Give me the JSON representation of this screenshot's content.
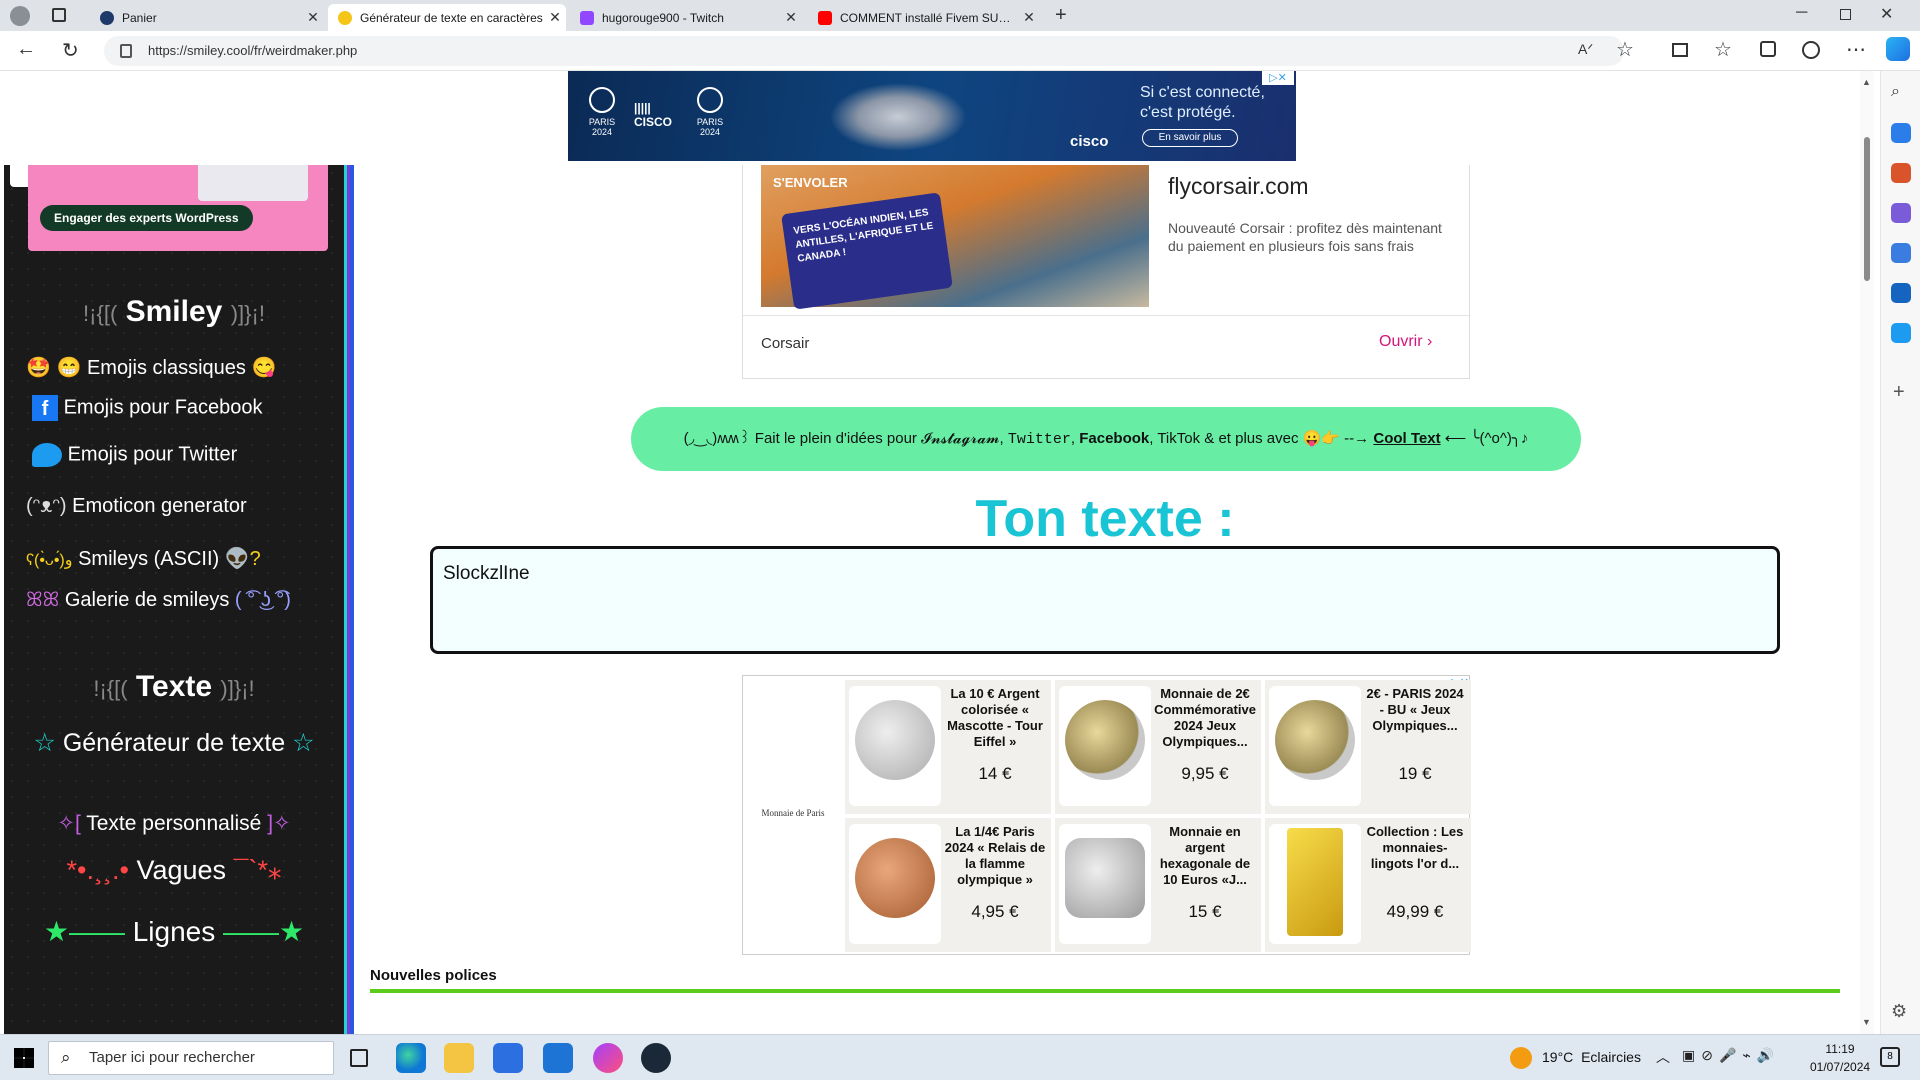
{
  "browser": {
    "tabs": [
      {
        "title": "Panier",
        "active": false
      },
      {
        "title": "Générateur de texte en caractères",
        "active": true
      },
      {
        "title": "hugorouge900 - Twitch",
        "active": false
      },
      {
        "title": "COMMENT installé Fivem SUR PC",
        "active": false
      }
    ],
    "url": "https://smiley.cool/fr/weirdmaker.php"
  },
  "ads": {
    "top_banner": {
      "line1": "Si c'est connecté,",
      "line2": "c'est protégé.",
      "cta": "En savoir plus",
      "brand": "cisco",
      "logo1": "PARIS 2024",
      "logo3": "PARIS 2024"
    },
    "corsair": {
      "domain": "flycorsair.com",
      "desc": "Nouveauté Corsair : profitez dès maintenant du paiement en plusieurs fois sans frais",
      "advertiser": "Corsair",
      "open": "Ouvrir",
      "image_text1": "S'ENVOLER",
      "image_text2": "VERS L'OCÉAN INDIEN, LES ANTILLES, L'AFRIQUE ET LE CANADA !"
    },
    "wordpress": {
      "cta": "Engager des experts WordPress"
    },
    "coins": {
      "sponsor": "Monnaie de Paris",
      "items": [
        {
          "name": "La 10 € Argent colorisée « Mascotte - Tour Eiffel »",
          "price": "14 €"
        },
        {
          "name": "Monnaie de 2€ Commémorative 2024 Jeux Olympiques...",
          "price": "9,95 €"
        },
        {
          "name": "2€ - PARIS 2024 - BU « Jeux Olympiques...",
          "price": "19 €"
        },
        {
          "name": "La 1/4€ Paris 2024 « Relais de la flamme olympique »",
          "price": "4,95 €"
        },
        {
          "name": "Monnaie en argent hexagonale de 10 Euros «J...",
          "price": "15 €"
        },
        {
          "name": "Collection : Les monnaies-lingots l'or d...",
          "price": "49,99 €"
        }
      ]
    }
  },
  "sidebar": {
    "sec1": {
      "deco_left": "!¡{[(",
      "title": "Smiley",
      "deco_right": ")]}¡!"
    },
    "items1": [
      {
        "label": "Emojis classiques",
        "pre": "🤩 😁",
        "post": "😋"
      },
      {
        "label": "Emojis pour Facebook"
      },
      {
        "label": "Emojis pour Twitter"
      },
      {
        "label": "Emoticon generator",
        "pre": "(ᵔᴥᵔ)"
      },
      {
        "label": "Smileys (ASCII)",
        "pre": "ʕ(•̀ᴗ•́)و",
        "post": "👽?"
      },
      {
        "label": "Galerie de smileys",
        "pre": "ꕤꕤ",
        "post": "( ͡° ͜ʖ ͡°)"
      }
    ],
    "sec2": {
      "deco_left": "!¡{[(",
      "title": "Texte",
      "deco_right": ")]}¡!"
    },
    "items2": [
      {
        "label": "Générateur de texte",
        "pre": "☆",
        "post": "☆"
      },
      {
        "label": "Texte personnalisé",
        "pre": "✧[",
        "post": "]✧"
      },
      {
        "label": "Vagues",
        "pre": "*•.¸¸.•",
        "post": "¯`*⁎"
      },
      {
        "label": "Lignes",
        "pre": "★——",
        "post": "——★"
      }
    ]
  },
  "main": {
    "promo": {
      "pre": "(◞‿◟)ʍʍ꒱ Fait le plein d'idées pour",
      "instagram": "𝓘𝓷𝓼𝓽𝓪𝓰𝓻𝓪𝓶",
      "twitter": "Twitter",
      "facebook": "Facebook",
      "mid": ", TikTok & et plus avec 😛👉 --→",
      "link": "Cool Text",
      "post": "⟵ ╰(^o^)╮♪"
    },
    "heading": "Ton texte :",
    "input_value": "SlockzlIne",
    "section_label": "Nouvelles polices"
  },
  "taskbar": {
    "search_placeholder": "Taper ici pour rechercher",
    "weather_temp": "19°C",
    "weather_desc": "Eclaircies",
    "time": "11:19",
    "date": "01/07/2024",
    "notif_count": "8"
  },
  "colors": {
    "accent_cyan": "#19c4d4",
    "promo_green": "#67eea4",
    "sidebar_bg": "#1a1a1a",
    "corsair_pink": "#d4157a"
  }
}
